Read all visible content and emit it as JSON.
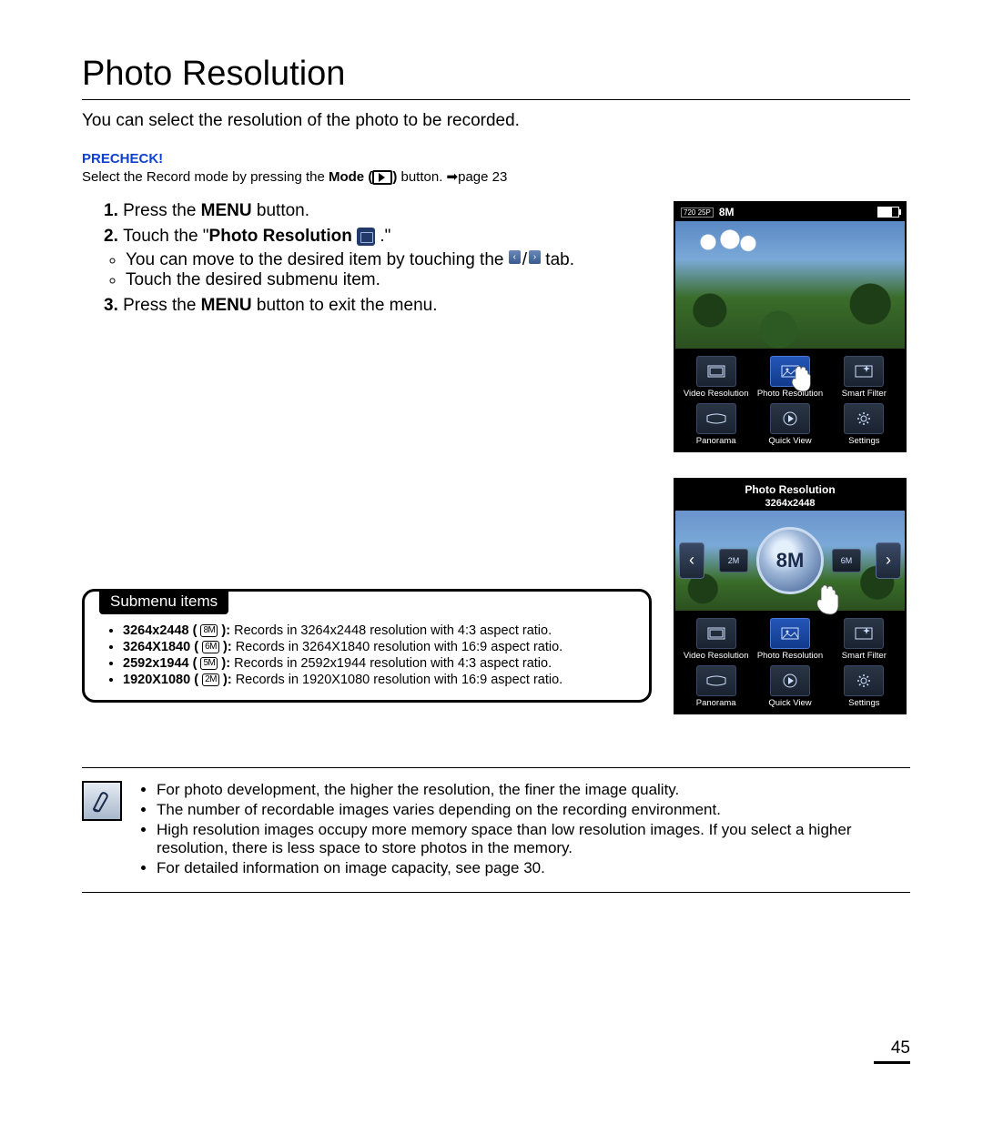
{
  "title": "Photo Resolution",
  "intro": "You can select the resolution of the photo to be recorded.",
  "precheck": {
    "label": "PRECHECK!",
    "text_before": "Select the Record mode by pressing the ",
    "mode_word": "Mode",
    "text_after": " button. ➡page 23"
  },
  "steps": {
    "s1_a": "Press the ",
    "s1_b": "MENU",
    "s1_c": " button.",
    "s2_a": "Touch the \"",
    "s2_b": "Photo Resolution",
    "s2_c": " .\"",
    "s2_sub1_a": "You can move to the desired item by touching the ",
    "s2_sub1_b": " tab.",
    "s2_sub2": "Touch the desired submenu item.",
    "s3_a": "Press the ",
    "s3_b": "MENU",
    "s3_c": " button to exit the menu."
  },
  "submenu": {
    "header": "Submenu items",
    "items": [
      {
        "res": "3264x2448",
        "mp": "8M",
        "desc": "Records in 3264x2448 resolution with 4:3 aspect ratio."
      },
      {
        "res": "3264X1840",
        "mp": "6M",
        "desc": "Records in 3264X1840 resolution with 16:9 aspect ratio."
      },
      {
        "res": "2592x1944",
        "mp": "5M",
        "desc": "Records in 2592x1944 resolution with 4:3 aspect ratio."
      },
      {
        "res": "1920X1080",
        "mp": "2M",
        "desc": "Records in 1920X1080 resolution with 16:9 aspect ratio."
      }
    ]
  },
  "notes": [
    "For photo development, the higher the resolution, the finer the image quality.",
    "The number of recordable images varies depending on the recording environment.",
    "High resolution images occupy more memory space than low resolution images. If you select a higher resolution, there is less space to store photos in the memory.",
    "For detailed information on image capacity, see page 30."
  ],
  "cam1": {
    "status_left1": "720 25P",
    "status_left2": "8M",
    "tiles": [
      {
        "label": "Video Resolution",
        "icon": "film"
      },
      {
        "label": "Photo Resolution",
        "icon": "photo",
        "selected": true,
        "hand": true
      },
      {
        "label": "Smart Filter",
        "icon": "filter"
      },
      {
        "label": "Panorama",
        "icon": "pano"
      },
      {
        "label": "Quick View",
        "icon": "play"
      },
      {
        "label": "Settings",
        "icon": "gear"
      }
    ]
  },
  "cam2": {
    "header": "Photo Resolution",
    "sub": "3264x2448",
    "center": "8M",
    "side_l": "2M",
    "side_r": "6M",
    "tiles": [
      {
        "label": "Video Resolution",
        "icon": "film"
      },
      {
        "label": "Photo Resolution",
        "icon": "photo",
        "selected": true
      },
      {
        "label": "Smart Filter",
        "icon": "filter"
      },
      {
        "label": "Panorama",
        "icon": "pano"
      },
      {
        "label": "Quick View",
        "icon": "play"
      },
      {
        "label": "Settings",
        "icon": "gear"
      }
    ]
  },
  "page_number": "45"
}
